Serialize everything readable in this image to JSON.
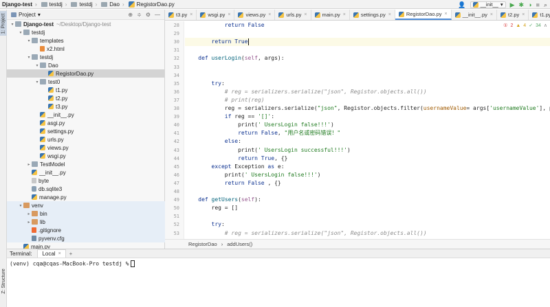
{
  "breadcrumbs": [
    "Django-test",
    "testdj",
    "testdj",
    "Dao",
    "RegistorDao.py"
  ],
  "run_config": {
    "label": "__init__"
  },
  "left_strip": {
    "project_tab": "1: Project",
    "structure_tab": "Z: Structure"
  },
  "project_panel": {
    "title": "Project",
    "tree": [
      {
        "label": "Django-test",
        "suffix": "~/Desktop/Django-test",
        "depth": 0,
        "type": "folder",
        "expanded": true,
        "bold": true
      },
      {
        "label": "testdj",
        "depth": 1,
        "type": "folder",
        "expanded": true
      },
      {
        "label": "templates",
        "depth": 2,
        "type": "folder",
        "expanded": true
      },
      {
        "label": "x2.html",
        "depth": 3,
        "type": "html"
      },
      {
        "label": "testdj",
        "depth": 2,
        "type": "folder",
        "expanded": true
      },
      {
        "label": "Dao",
        "depth": 3,
        "type": "folder",
        "expanded": true
      },
      {
        "label": "RegistorDao.py",
        "depth": 4,
        "type": "py",
        "selected": true
      },
      {
        "label": "test0",
        "depth": 3,
        "type": "folder",
        "expanded": true
      },
      {
        "label": "t1.py",
        "depth": 4,
        "type": "py"
      },
      {
        "label": "t2.py",
        "depth": 4,
        "type": "py"
      },
      {
        "label": "t3.py",
        "depth": 4,
        "type": "py"
      },
      {
        "label": "__init__.py",
        "depth": 3,
        "type": "py"
      },
      {
        "label": "asgi.py",
        "depth": 3,
        "type": "py"
      },
      {
        "label": "settings.py",
        "depth": 3,
        "type": "py"
      },
      {
        "label": "urls.py",
        "depth": 3,
        "type": "py"
      },
      {
        "label": "views.py",
        "depth": 3,
        "type": "py"
      },
      {
        "label": "wsgi.py",
        "depth": 3,
        "type": "py"
      },
      {
        "label": "TestModel",
        "depth": 2,
        "type": "folder",
        "expanded": false
      },
      {
        "label": "__init__.py",
        "depth": 2,
        "type": "py"
      },
      {
        "label": "byte",
        "depth": 2,
        "type": "file"
      },
      {
        "label": "db.sqlite3",
        "depth": 2,
        "type": "db"
      },
      {
        "label": "manage.py",
        "depth": 2,
        "type": "py"
      },
      {
        "label": "venv",
        "depth": 1,
        "type": "folder-orange",
        "expanded": true,
        "venv": true
      },
      {
        "label": "bin",
        "depth": 2,
        "type": "folder-orange",
        "expanded": false,
        "venv": true
      },
      {
        "label": "lib",
        "depth": 2,
        "type": "folder-orange",
        "expanded": false,
        "venv": true
      },
      {
        "label": ".gitignore",
        "depth": 2,
        "type": "git",
        "venv": true
      },
      {
        "label": "pyvenv.cfg",
        "depth": 2,
        "type": "cfg",
        "venv": true
      },
      {
        "label": "main.py",
        "depth": 1,
        "type": "py"
      }
    ]
  },
  "editor_tabs": [
    {
      "label": "t3.py",
      "active": false
    },
    {
      "label": "wsgi.py",
      "active": false
    },
    {
      "label": "views.py",
      "active": false
    },
    {
      "label": "urls.py",
      "active": false
    },
    {
      "label": "main.py",
      "active": false
    },
    {
      "label": "settings.py",
      "active": false
    },
    {
      "label": "RegistorDao.py",
      "active": true
    },
    {
      "label": "__init__.py",
      "active": false
    },
    {
      "label": "t2.py",
      "active": false
    },
    {
      "label": "t1.py",
      "active": false
    }
  ],
  "inspections": {
    "errors": "2",
    "warnings": "4",
    "ok": "34"
  },
  "code_lines": [
    {
      "n": "28",
      "html": "            <span class=\"kw\">return</span> <span class=\"kw\">False</span>"
    },
    {
      "n": "29",
      "html": ""
    },
    {
      "n": "30",
      "html": "        <span class=\"kw\">return</span> <span class=\"kw\">True</span><span class=\"caret\"></span>",
      "current": true
    },
    {
      "n": "31",
      "html": ""
    },
    {
      "n": "32",
      "html": "    <span class=\"kw\">def</span> <span class=\"fn\">userLogin</span>(<span class=\"self\">self</span>, args):"
    },
    {
      "n": "33",
      "html": ""
    },
    {
      "n": "34",
      "html": ""
    },
    {
      "n": "35",
      "html": "        <span class=\"kw\">try</span>:"
    },
    {
      "n": "36",
      "html": "            <span class=\"cmt\"># reg = serializers.serialize(\"json\", Registor.objects.all())</span>"
    },
    {
      "n": "37",
      "html": "            <span class=\"cmt\"># print(reg)</span>"
    },
    {
      "n": "38",
      "html": "            reg = serializers.serialize(<span class=\"str\">\"json\"</span>, Registor.objects.filter(<span class=\"param\">usernameValue</span>= args[<span class=\"str\">'usernameValue'</span>], passwo"
    },
    {
      "n": "39",
      "html": "            <span class=\"kw\">if</span> reg == <span class=\"str\">'[]'</span>:"
    },
    {
      "n": "40",
      "html": "                print(<span class=\"str\">' UsersLogin false!!!'</span>)"
    },
    {
      "n": "41",
      "html": "                <span class=\"kw\">return</span> <span class=\"kw\">False</span>, <span class=\"str\">\"用户名或密码错误！\"</span>"
    },
    {
      "n": "42",
      "html": "            <span class=\"kw\">else</span>:"
    },
    {
      "n": "43",
      "html": "                print(<span class=\"str\">' UsersLogin successful!!!'</span>)"
    },
    {
      "n": "44",
      "html": "                <span class=\"kw\">return</span> <span class=\"kw\">True</span>, {}"
    },
    {
      "n": "45",
      "html": "        <span class=\"kw\">except</span> Exception <span class=\"kw\">as</span> e:"
    },
    {
      "n": "46",
      "html": "            print(<span class=\"str\">' UsersLogin false!!!'</span>)"
    },
    {
      "n": "47",
      "html": "            <span class=\"kw\">return</span> <span class=\"kw\">False</span> , {}"
    },
    {
      "n": "48",
      "html": ""
    },
    {
      "n": "49",
      "html": "    <span class=\"kw\">def</span> <span class=\"fn\">getUsers</span>(<span class=\"self\">self</span>):"
    },
    {
      "n": "50",
      "html": "        reg = []"
    },
    {
      "n": "51",
      "html": ""
    },
    {
      "n": "52",
      "html": "        <span class=\"kw\">try</span>:"
    },
    {
      "n": "53",
      "html": "            <span class=\"cmt\"># reg = serializers.serialize(\"json\", Registor.objects.all())</span>"
    }
  ],
  "editor_breadcrumb": [
    "RegistorDao",
    "addUsers()"
  ],
  "terminal": {
    "label": "Terminal:",
    "tab": "Local",
    "add": "+",
    "prompt": "(venv) cqa@cqas-MacBook-Pro testdj %"
  }
}
